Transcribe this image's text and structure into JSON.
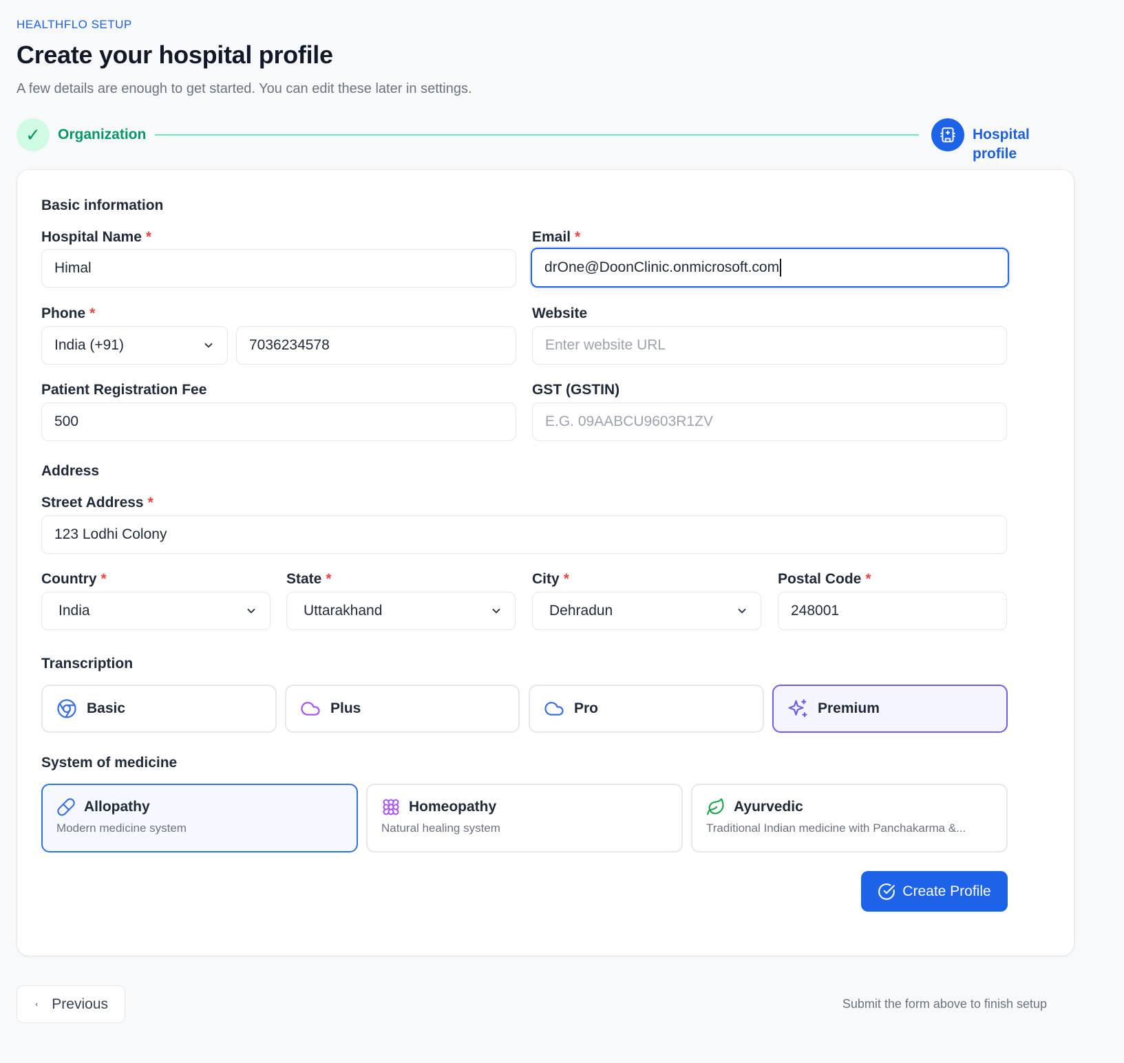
{
  "header": {
    "eyebrow": "HEALTHFLO SETUP",
    "title": "Create your hospital profile",
    "subtitle": "A few details are enough to get started. You can edit these later in settings."
  },
  "stepper": {
    "steps": [
      {
        "label": "Organization",
        "status": "complete",
        "icon": "check-icon"
      },
      {
        "label": "Hospital profile",
        "status": "active",
        "icon": "hospital-icon"
      }
    ]
  },
  "form": {
    "basic_title": "Basic information",
    "hospital_name": {
      "label": "Hospital Name",
      "required": "*",
      "value": "Himal"
    },
    "email": {
      "label": "Email",
      "required": "*",
      "value": "drOne@DoonClinic.onmicrosoft.com"
    },
    "phone": {
      "label": "Phone",
      "required": "*",
      "country_code": "India (+91)",
      "value": "7036234578"
    },
    "website": {
      "label": "Website",
      "placeholder": "Enter website URL"
    },
    "reg_fee": {
      "label": "Patient Registration Fee",
      "value": "500"
    },
    "gst": {
      "label": "GST (GSTIN)",
      "placeholder": "E.G. 09AABCU9603R1ZV"
    },
    "address_title": "Address",
    "street": {
      "label": "Street Address",
      "required": "*",
      "value": "123 Lodhi Colony"
    },
    "country": {
      "label": "Country",
      "required": "*",
      "value": "India"
    },
    "state": {
      "label": "State",
      "required": "*",
      "value": "Uttarakhand"
    },
    "city": {
      "label": "City",
      "required": "*",
      "value": "Dehradun"
    },
    "postal": {
      "label": "Postal Code",
      "required": "*",
      "value": "248001"
    },
    "transcription_title": "Transcription",
    "transcription": [
      {
        "label": "Basic",
        "icon": "chrome-icon",
        "selected": false
      },
      {
        "label": "Plus",
        "icon": "cloud-icon",
        "selected": false
      },
      {
        "label": "Pro",
        "icon": "cloud-icon",
        "selected": false
      },
      {
        "label": "Premium",
        "icon": "sparkles-icon",
        "selected": true
      }
    ],
    "medicine_title": "System of medicine",
    "medicine": [
      {
        "label": "Allopathy",
        "desc": "Modern medicine system",
        "icon": "pill-icon",
        "selected": true
      },
      {
        "label": "Homeopathy",
        "desc": "Natural healing system",
        "icon": "flower-icon",
        "selected": false
      },
      {
        "label": "Ayurvedic",
        "desc": "Traditional Indian medicine with Panchakarma &...",
        "icon": "leaf-icon",
        "selected": false
      }
    ],
    "submit_label": "Create Profile"
  },
  "footer": {
    "previous_label": "Previous",
    "note": "Submit the form above to finish setup"
  },
  "colors": {
    "accent": "#1d63ea",
    "success": "#059669",
    "premium": "#6d5cf0",
    "required": "#ef4444"
  }
}
